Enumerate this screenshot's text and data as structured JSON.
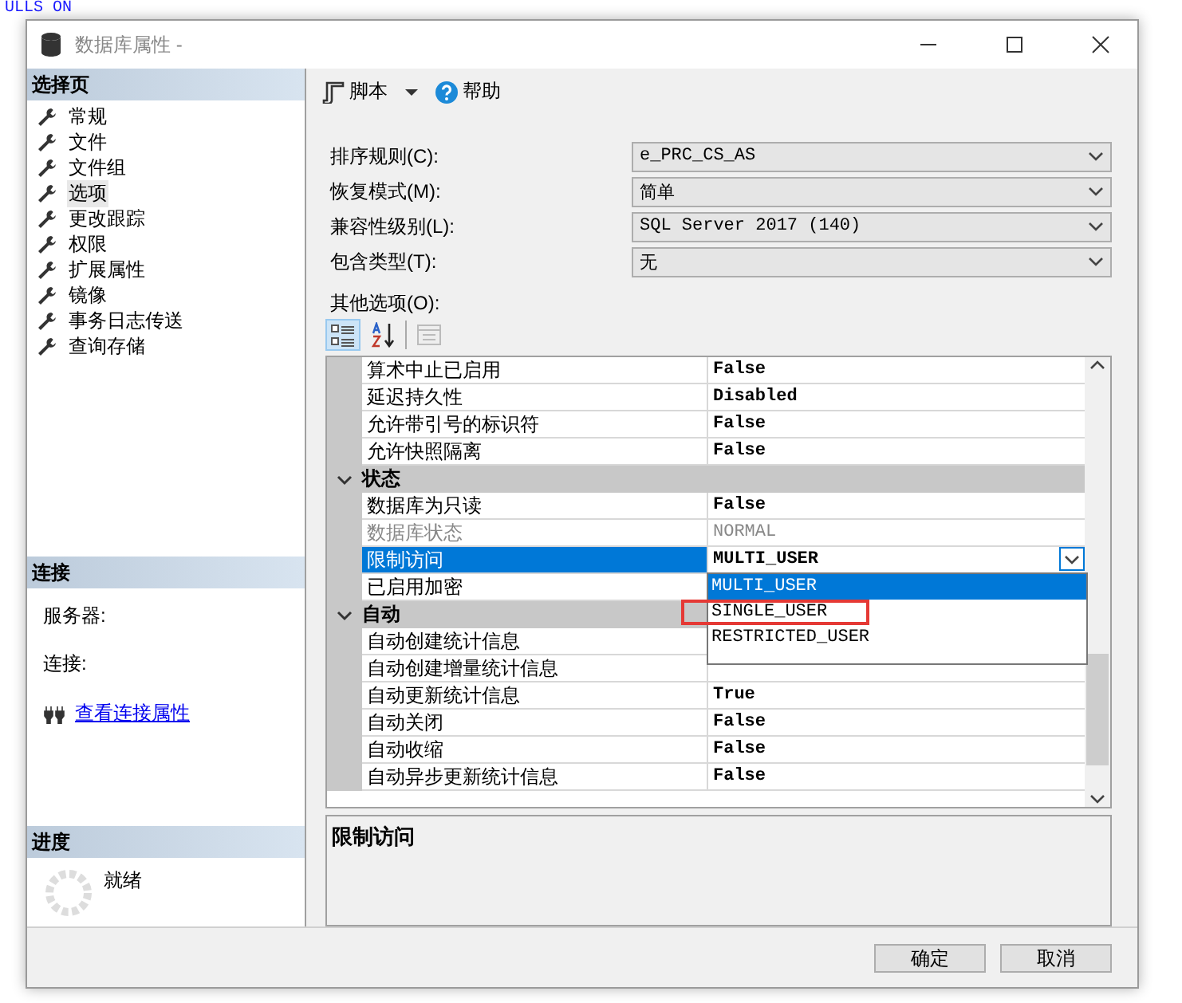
{
  "backdrop": {
    "code_line": "ULLS ON"
  },
  "window": {
    "title": "数据库属性 - "
  },
  "sidebar": {
    "pages_header": "选择页",
    "items": [
      {
        "label": "常规",
        "selected": false
      },
      {
        "label": "文件",
        "selected": false
      },
      {
        "label": "文件组",
        "selected": false
      },
      {
        "label": "选项",
        "selected": true
      },
      {
        "label": "更改跟踪",
        "selected": false
      },
      {
        "label": "权限",
        "selected": false
      },
      {
        "label": "扩展属性",
        "selected": false
      },
      {
        "label": "镜像",
        "selected": false
      },
      {
        "label": "事务日志传送",
        "selected": false
      },
      {
        "label": "查询存储",
        "selected": false
      }
    ],
    "connection": {
      "header": "连接",
      "server_label": "服务器:",
      "connection_label": "连接:",
      "link": "查看连接属性"
    },
    "progress": {
      "header": "进度",
      "status": "就绪"
    }
  },
  "toolbar": [
    {
      "kind": "script",
      "label": "脚本"
    },
    {
      "kind": "help",
      "label": "帮助"
    }
  ],
  "form": [
    {
      "label": "排序规则(C):",
      "value": "e_PRC_CS_AS"
    },
    {
      "label": "恢复模式(M):",
      "value": "简单"
    },
    {
      "label": "兼容性级别(L):",
      "value": "SQL Server 2017 (140)"
    },
    {
      "label": "包含类型(T):",
      "value": "无"
    }
  ],
  "other_options": {
    "label": "其他选项(O):",
    "grid_tools": [
      {
        "kind": "categorized",
        "selected": true,
        "disabled": false
      },
      {
        "kind": "alphabetical",
        "selected": false,
        "disabled": false
      },
      {
        "kind": "property_pages",
        "selected": false,
        "disabled": true
      }
    ]
  },
  "grid": {
    "sections": [
      {
        "rows": [
          {
            "name": "算术中止已启用",
            "value": "False",
            "selected": false,
            "disabled": false
          },
          {
            "name": "延迟持久性",
            "value": "Disabled",
            "selected": false,
            "disabled": false
          },
          {
            "name": "允许带引号的标识符",
            "value": "False",
            "selected": false,
            "disabled": false
          },
          {
            "name": "允许快照隔离",
            "value": "False",
            "selected": false,
            "disabled": false
          }
        ]
      },
      {
        "title": "状态",
        "expanded": true,
        "rows": [
          {
            "name": "数据库为只读",
            "value": "False",
            "selected": false,
            "disabled": false
          },
          {
            "name": "数据库状态",
            "value": "NORMAL",
            "selected": false,
            "disabled": true
          },
          {
            "name": "限制访问",
            "value": "MULTI_USER",
            "selected": true,
            "disabled": false,
            "dropdown": [
              {
                "label": "MULTI_USER",
                "selected": true,
                "highlighted": false
              },
              {
                "label": "SINGLE_USER",
                "selected": false,
                "highlighted": true
              },
              {
                "label": "RESTRICTED_USER",
                "selected": false,
                "highlighted": false
              }
            ]
          },
          {
            "name": "已启用加密",
            "selected": false,
            "disabled": false
          }
        ]
      },
      {
        "title": "自动",
        "expanded": true,
        "rows": [
          {
            "name": "自动创建统计信息",
            "selected": false,
            "disabled": false
          },
          {
            "name": "自动创建增量统计信息",
            "selected": false,
            "disabled": false
          },
          {
            "name": "自动更新统计信息",
            "value": "True",
            "selected": false,
            "disabled": false
          },
          {
            "name": "自动关闭",
            "value": "False",
            "selected": false,
            "disabled": false
          },
          {
            "name": "自动收缩",
            "value": "False",
            "selected": false,
            "disabled": false
          },
          {
            "name": "自动异步更新统计信息",
            "value": "False",
            "selected": false,
            "disabled": false
          }
        ]
      }
    ]
  },
  "description": {
    "title": "限制访问"
  },
  "buttons": [
    {
      "label": "确定"
    },
    {
      "label": "取消"
    }
  ]
}
